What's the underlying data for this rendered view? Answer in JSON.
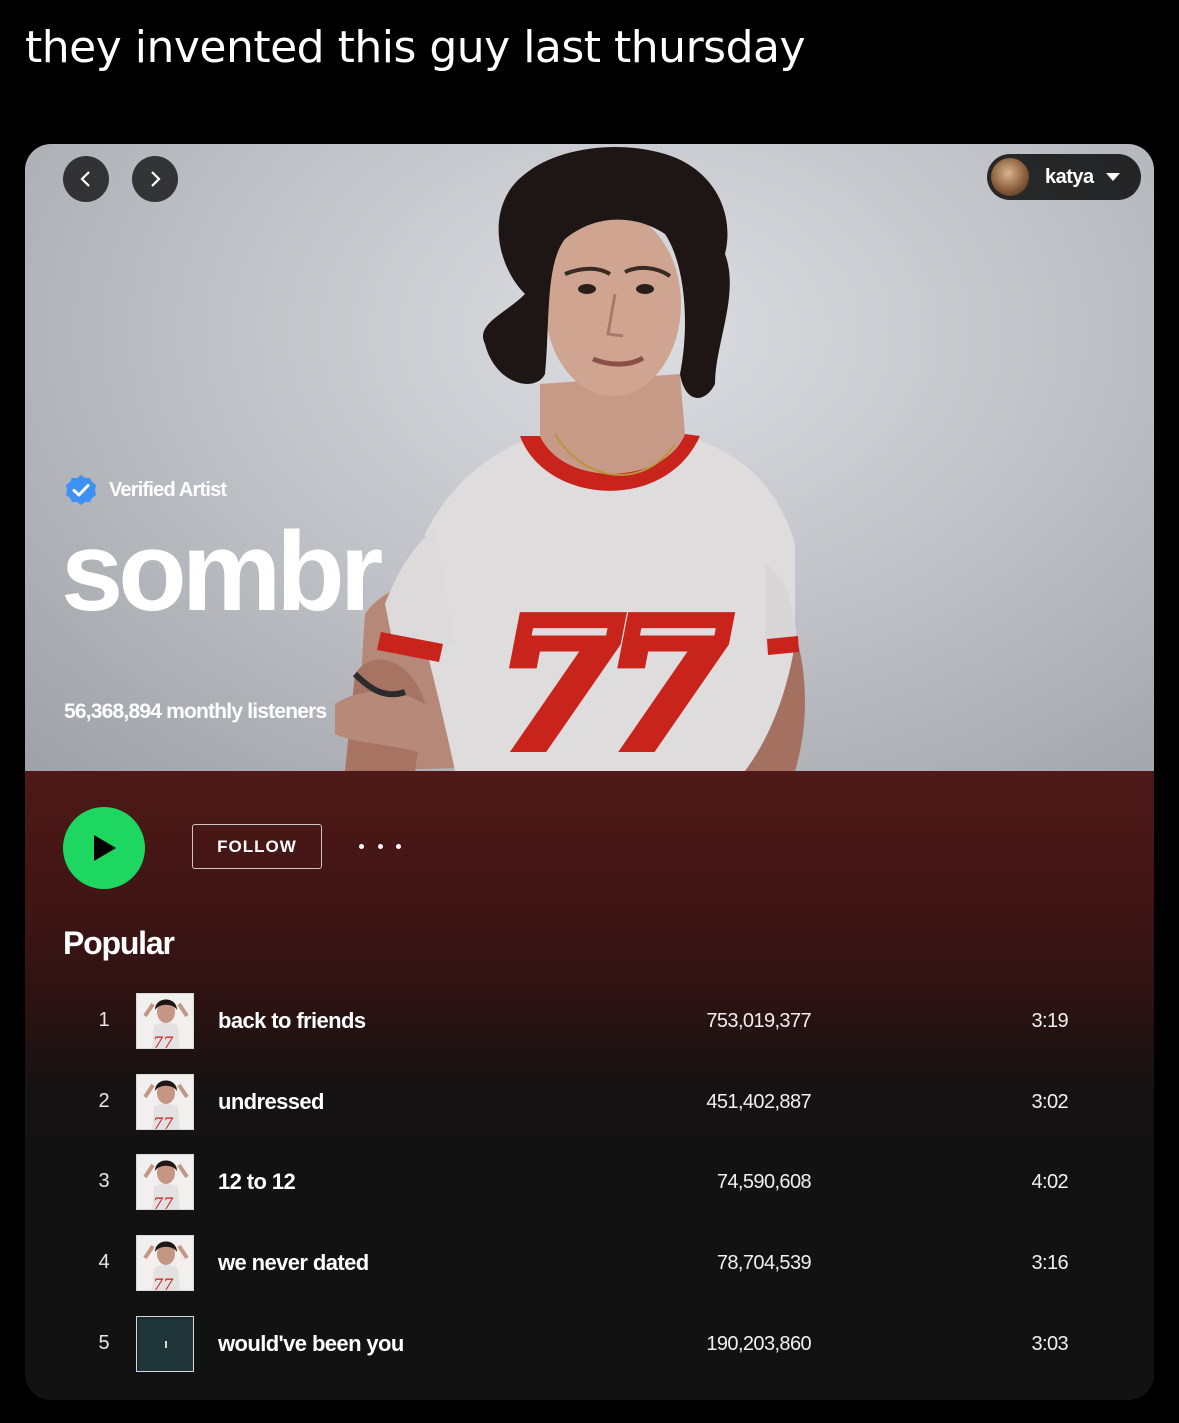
{
  "post": {
    "caption": "they invented this guy last thursday"
  },
  "header": {
    "user": {
      "name": "katya"
    }
  },
  "artist": {
    "verified_label": "Verified Artist",
    "name": "sombr",
    "monthly_listeners": "56,368,894 monthly listeners",
    "shirt_number": "77"
  },
  "actions": {
    "follow_label": "FOLLOW"
  },
  "popular": {
    "title": "Popular",
    "tracks": [
      {
        "rank": "1",
        "title": "back to friends",
        "plays": "753,019,377",
        "duration": "3:19",
        "cover": "artist-photo"
      },
      {
        "rank": "2",
        "title": "undressed",
        "plays": "451,402,887",
        "duration": "3:02",
        "cover": "artist-photo"
      },
      {
        "rank": "3",
        "title": "12 to 12",
        "plays": "74,590,608",
        "duration": "4:02",
        "cover": "artist-photo"
      },
      {
        "rank": "4",
        "title": "we never dated",
        "plays": "78,704,539",
        "duration": "3:16",
        "cover": "artist-photo"
      },
      {
        "rank": "5",
        "title": "would've been you",
        "plays": "190,203,860",
        "duration": "3:03",
        "cover": "dark-teal"
      }
    ]
  },
  "colors": {
    "play_button": "#1ed760",
    "verified_badge": "#3d91f4",
    "shirt_trim": "#c8241c"
  }
}
